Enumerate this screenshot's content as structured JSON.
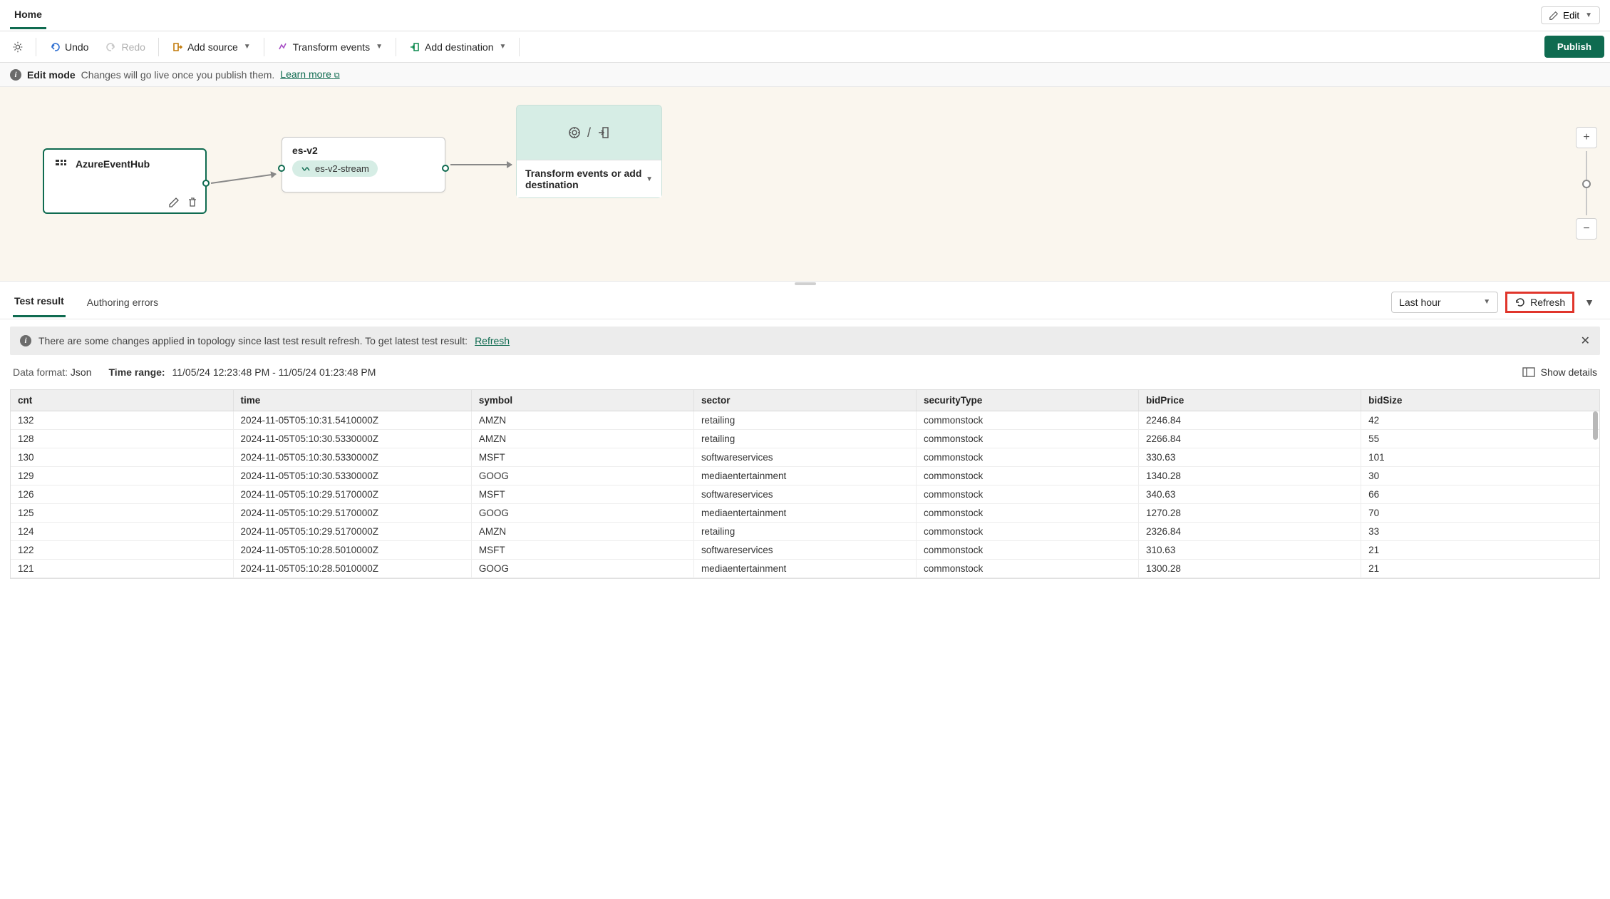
{
  "header": {
    "home_tab": "Home",
    "edit_label": "Edit"
  },
  "toolbar": {
    "undo": "Undo",
    "redo": "Redo",
    "add_source": "Add source",
    "transform_events": "Transform events",
    "add_destination": "Add destination",
    "publish": "Publish"
  },
  "edit_mode": {
    "title": "Edit mode",
    "message": "Changes will go live once you publish them.",
    "learn_more": "Learn more"
  },
  "canvas": {
    "azure_node": "AzureEventHub",
    "es_node_title": "es-v2",
    "es_stream": "es-v2-stream",
    "dest_label": "Transform events or add destination"
  },
  "lower_tabs": {
    "test_result": "Test result",
    "authoring_errors": "Authoring errors",
    "time_selector": "Last hour",
    "refresh": "Refresh"
  },
  "alert": {
    "message": "There are some changes applied in topology since last test result refresh. To get latest test result:",
    "action": "Refresh"
  },
  "meta": {
    "data_format_label": "Data format:",
    "data_format_value": "Json",
    "time_range_label": "Time range:",
    "time_range_value": "11/05/24 12:23:48 PM - 11/05/24 01:23:48 PM",
    "show_details": "Show details"
  },
  "table": {
    "headers": [
      "cnt",
      "time",
      "symbol",
      "sector",
      "securityType",
      "bidPrice",
      "bidSize"
    ],
    "rows": [
      [
        "132",
        "2024-11-05T05:10:31.5410000Z",
        "AMZN",
        "retailing",
        "commonstock",
        "2246.84",
        "42"
      ],
      [
        "128",
        "2024-11-05T05:10:30.5330000Z",
        "AMZN",
        "retailing",
        "commonstock",
        "2266.84",
        "55"
      ],
      [
        "130",
        "2024-11-05T05:10:30.5330000Z",
        "MSFT",
        "softwareservices",
        "commonstock",
        "330.63",
        "101"
      ],
      [
        "129",
        "2024-11-05T05:10:30.5330000Z",
        "GOOG",
        "mediaentertainment",
        "commonstock",
        "1340.28",
        "30"
      ],
      [
        "126",
        "2024-11-05T05:10:29.5170000Z",
        "MSFT",
        "softwareservices",
        "commonstock",
        "340.63",
        "66"
      ],
      [
        "125",
        "2024-11-05T05:10:29.5170000Z",
        "GOOG",
        "mediaentertainment",
        "commonstock",
        "1270.28",
        "70"
      ],
      [
        "124",
        "2024-11-05T05:10:29.5170000Z",
        "AMZN",
        "retailing",
        "commonstock",
        "2326.84",
        "33"
      ],
      [
        "122",
        "2024-11-05T05:10:28.5010000Z",
        "MSFT",
        "softwareservices",
        "commonstock",
        "310.63",
        "21"
      ],
      [
        "121",
        "2024-11-05T05:10:28.5010000Z",
        "GOOG",
        "mediaentertainment",
        "commonstock",
        "1300.28",
        "21"
      ]
    ]
  }
}
